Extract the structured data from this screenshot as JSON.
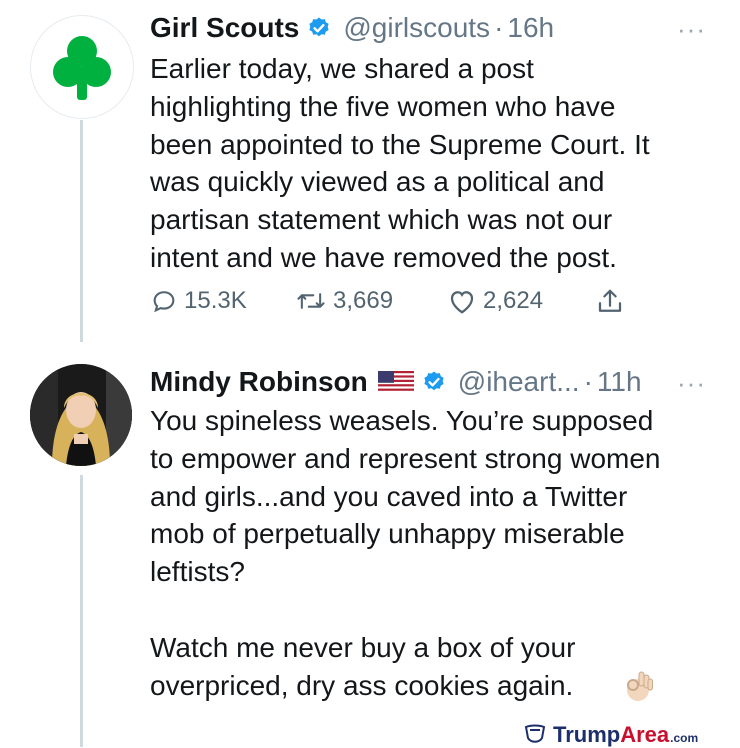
{
  "tweets": [
    {
      "name": "Girl Scouts",
      "handle": "@girlscouts",
      "separator": "·",
      "time": "16h",
      "more": "···",
      "verified": true,
      "text": "Earlier today, we shared a post\nhighlighting the five women who have\nbeen appointed to the Supreme Court. It\nwas quickly viewed as a political and\npartisan statement which was not our\nintent and we have removed the post.",
      "actions": {
        "replies": "15.3K",
        "retweets": "3,669",
        "likes": "2,624"
      },
      "avatar_icon": "girl-scouts-trefoil-logo"
    },
    {
      "name": "Mindy Robinson",
      "handle": "@iheart...",
      "separator": "·",
      "time": "11h",
      "more": "···",
      "verified": true,
      "flag_icon": "us-flag-icon",
      "text": "You spineless weasels. You’re supposed\nto empower and represent strong women\nand girls...and you caved into a Twitter\nmob of perpetually unhappy miserable\nleftists?\n\nWatch me never buy a box of your\noverpriced, dry ass cookies again.",
      "emoji_icon": "ok-hand-emoji-icon",
      "avatar_icon": "user-avatar-photo"
    }
  ],
  "watermark": {
    "brand": "Trump",
    "accent": "Area",
    "suffix": ".com",
    "icon": "shield-logo-icon"
  },
  "colors": {
    "verified": "#1d9bf0",
    "trefoil": "#00b140",
    "muted": "#657786",
    "watermark_blue": "#1c2f6b",
    "watermark_red": "#c8102e"
  }
}
